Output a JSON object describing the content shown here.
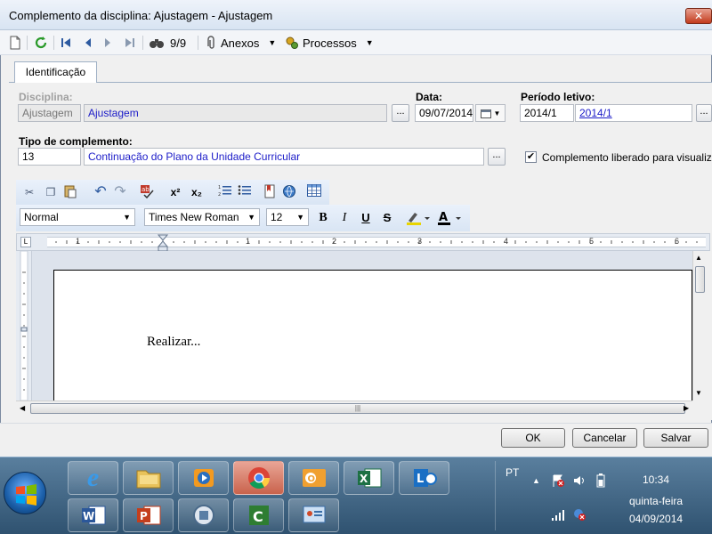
{
  "window": {
    "title": "Complemento da disciplina: Ajustagem - Ajustagem",
    "close_glyph": "✕"
  },
  "toolbar": {
    "record_counter": "9/9",
    "anexos_label": "Anexos",
    "processos_label": "Processos"
  },
  "tabs": [
    {
      "label": "Identificação",
      "active": true
    }
  ],
  "form": {
    "disciplina_label": "Disciplina:",
    "disciplina_code": "Ajustagem",
    "disciplina_name": "Ajustagem",
    "data_label": "Data:",
    "data_value": "09/07/2014",
    "periodo_label": "Período letivo:",
    "periodo_code": "2014/1",
    "periodo_name": "2014/1",
    "tipo_label": "Tipo de complemento:",
    "tipo_code": "13",
    "tipo_name": "Continuação do Plano da Unidade Curricular",
    "liberado_label": "Complemento liberado para visualização",
    "liberado_checked": true,
    "browse_label": "..."
  },
  "editor": {
    "style_value": "Normal",
    "font_value": "Times New Roman",
    "size_value": "12",
    "bold": "B",
    "italic": "I",
    "underline": "U",
    "strike": "S",
    "superscript": "x²",
    "subscript": "x₂",
    "ruler_numbers": [
      "1",
      "1",
      "2",
      "3",
      "4",
      "5",
      "6"
    ],
    "content": "Realizar..."
  },
  "buttons": {
    "ok": "OK",
    "cancel": "Cancelar",
    "save": "Salvar"
  },
  "taskbar": {
    "apps": [
      "internet-explorer",
      "file-explorer",
      "media-player",
      "chrome",
      "outlook",
      "excel",
      "lync",
      "word",
      "powerpoint",
      "app-circle",
      "camtasia",
      "control-panel"
    ],
    "language": "PT",
    "time": "10:34",
    "weekday": "quinta-feira",
    "date": "04/09/2014"
  }
}
